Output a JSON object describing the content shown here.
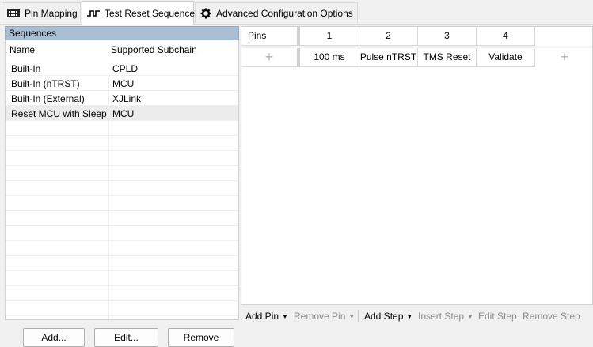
{
  "tabs": [
    {
      "label": "Pin Mapping",
      "icon": "pin-mapping-icon",
      "active": false
    },
    {
      "label": "Test Reset Sequence",
      "icon": "waveform-icon",
      "active": true
    },
    {
      "label": "Advanced Configuration Options",
      "icon": "gear-icon",
      "active": false
    }
  ],
  "sequences": {
    "title": "Sequences",
    "col_name": "Name",
    "col_subchain": "Supported Subchain",
    "rows": [
      {
        "name": "Built-In",
        "subchain": "CPLD"
      },
      {
        "name": "Built-In (nTRST)",
        "subchain": "MCU"
      },
      {
        "name": "Built-In (External)",
        "subchain": "XJLink"
      },
      {
        "name": "Reset MCU with Sleep",
        "subchain": "MCU"
      }
    ],
    "selected_index": 3,
    "buttons": {
      "add": "Add...",
      "edit": "Edit...",
      "remove": "Remove"
    }
  },
  "grid": {
    "pins_header": "Pins",
    "step_numbers": [
      "1",
      "2",
      "3",
      "4"
    ],
    "steps": [
      "100 ms",
      "Pulse nTRST",
      "TMS Reset",
      "Validate"
    ],
    "add_symbol": "+"
  },
  "toolbar": {
    "add_pin": "Add Pin",
    "remove_pin": "Remove Pin",
    "add_step": "Add Step",
    "insert_step": "Insert Step",
    "edit_step": "Edit Step",
    "remove_step": "Remove Step"
  }
}
